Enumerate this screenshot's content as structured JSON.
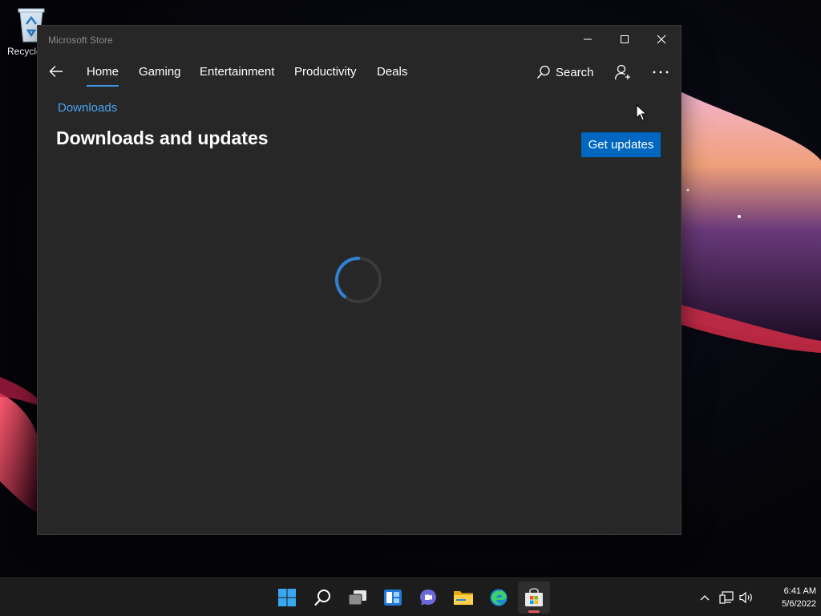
{
  "desktop": {
    "recycle_bin_label": "Recycle"
  },
  "window": {
    "title": "Microsoft Store",
    "nav": {
      "tabs": [
        {
          "label": "Home",
          "active": true
        },
        {
          "label": "Gaming",
          "active": false
        },
        {
          "label": "Entertainment",
          "active": false
        },
        {
          "label": "Productivity",
          "active": false
        },
        {
          "label": "Deals",
          "active": false
        }
      ],
      "search_label": "Search"
    },
    "breadcrumb": "Downloads",
    "page_title": "Downloads and updates",
    "get_updates_label": "Get updates",
    "loading": true
  },
  "taskbar": {
    "apps": [
      "start",
      "search",
      "task-view",
      "widgets",
      "teams-chat",
      "file-explorer",
      "edge",
      "microsoft-store"
    ],
    "active_app": "microsoft-store",
    "clock": {
      "time": "6:41 AM",
      "date": "5/6/2022"
    }
  },
  "colors": {
    "accent": "#0067c0",
    "link": "#4aa3f0",
    "tab_indicator": "#3e95e5",
    "window_bg": "#272727",
    "taskbar_bg": "#1c1c1c"
  }
}
